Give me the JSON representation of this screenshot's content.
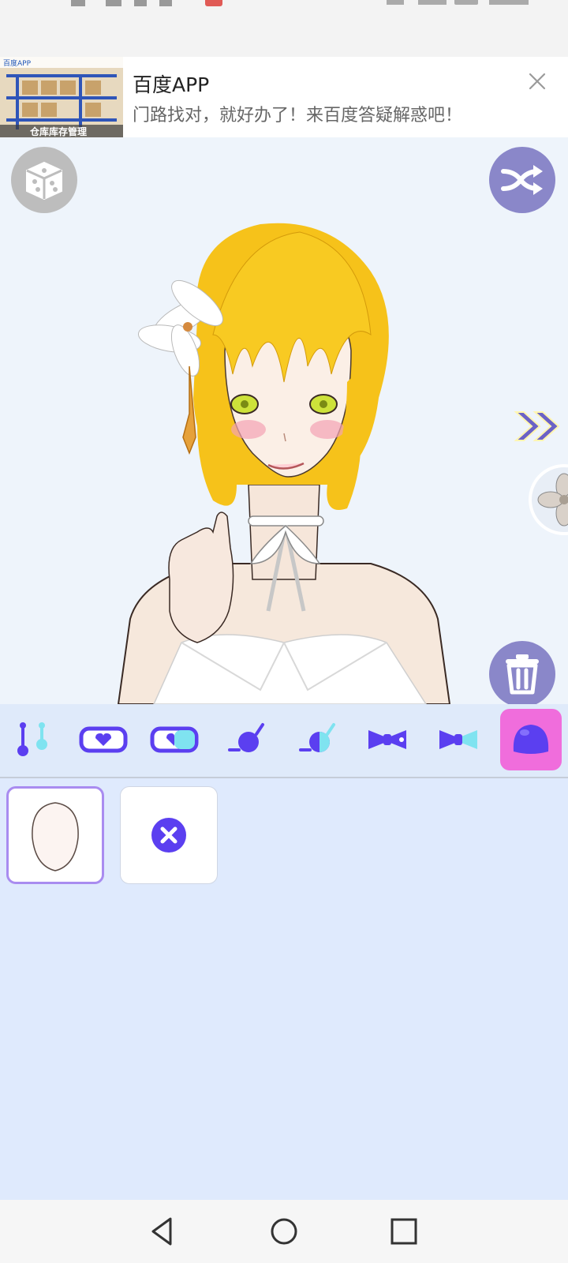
{
  "ad": {
    "title": "百度APP",
    "subtitle": "门路找对，就好办了！来百度答疑解惑吧！",
    "thumbnail_brand": "百度APP",
    "thumbnail_caption": "仓库库存管理",
    "close_icon": "close-icon"
  },
  "stage": {
    "dice_icon": "dice-icon",
    "shuffle_icon": "shuffle-icon",
    "next_icon": "double-chevron-right-icon",
    "flower_icon": "flower-icon",
    "trash_icon": "trash-icon"
  },
  "toolbar": {
    "items": [
      {
        "icon": "earring-dangle-icon",
        "active": false
      },
      {
        "icon": "heart-choker-icon",
        "active": false
      },
      {
        "icon": "choker-half-icon",
        "active": false
      },
      {
        "icon": "pin-ball-icon",
        "active": false
      },
      {
        "icon": "pin-half-icon",
        "active": false
      },
      {
        "icon": "bow-icon",
        "active": false
      },
      {
        "icon": "bow-half-icon",
        "active": false
      },
      {
        "icon": "blob-hair-icon",
        "active": true
      }
    ]
  },
  "options": [
    {
      "icon": "face-base-icon",
      "selected": true
    },
    {
      "icon": "remove-icon",
      "selected": false
    }
  ],
  "colors": {
    "accent": "#5b3ff0",
    "stage_bg": "#eef4fb",
    "panel_bg": "#dfeafd",
    "active_tab": "#f06ddc",
    "shuffle_bg": "#8a87c9",
    "dice_bg": "#bdbdbd"
  }
}
